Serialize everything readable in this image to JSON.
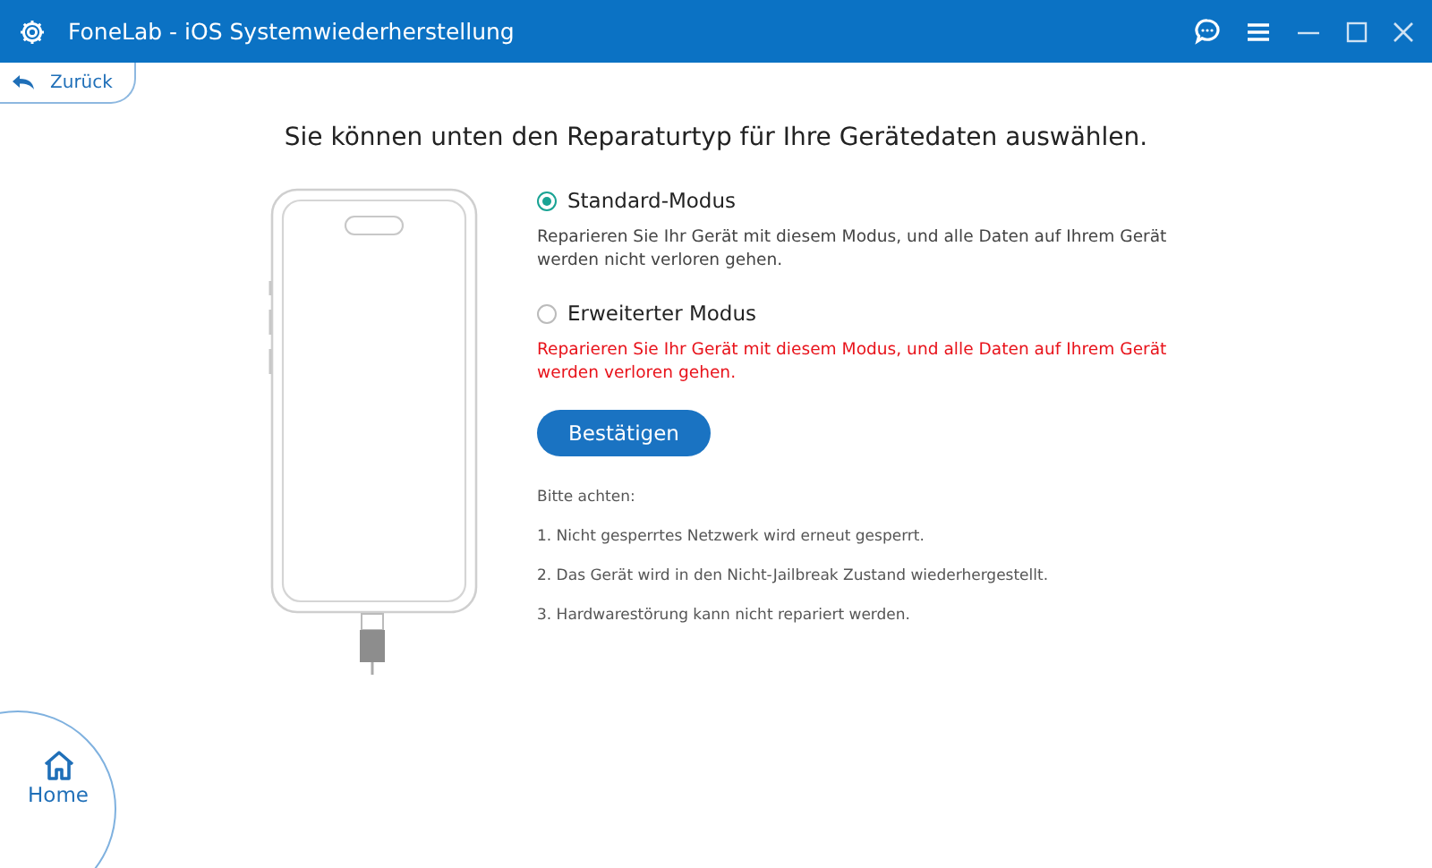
{
  "window": {
    "title": "FoneLab - iOS Systemwiederherstellung"
  },
  "back_button": {
    "label": "Zurück"
  },
  "heading": "Sie können unten den Reparaturtyp für Ihre Gerätedaten auswählen.",
  "modes": [
    {
      "label": "Standard-Modus",
      "selected": true,
      "description": "Reparieren Sie Ihr Gerät mit diesem Modus, und alle Daten auf Ihrem Gerät werden nicht verloren gehen.",
      "warning": false
    },
    {
      "label": "Erweiterter Modus",
      "selected": false,
      "description": "Reparieren Sie Ihr Gerät mit diesem Modus, und alle Daten auf Ihrem Gerät werden verloren gehen.",
      "warning": true
    }
  ],
  "confirm_button": "Bestätigen",
  "notes": {
    "title": "Bitte achten:",
    "items": [
      "1. Nicht gesperrtes Netzwerk wird erneut gesperrt.",
      "2. Das Gerät wird in den Nicht-Jailbreak Zustand wiederhergestellt.",
      "3. Hardwarestörung kann nicht repariert werden."
    ]
  },
  "home_button": {
    "label": "Home"
  }
}
